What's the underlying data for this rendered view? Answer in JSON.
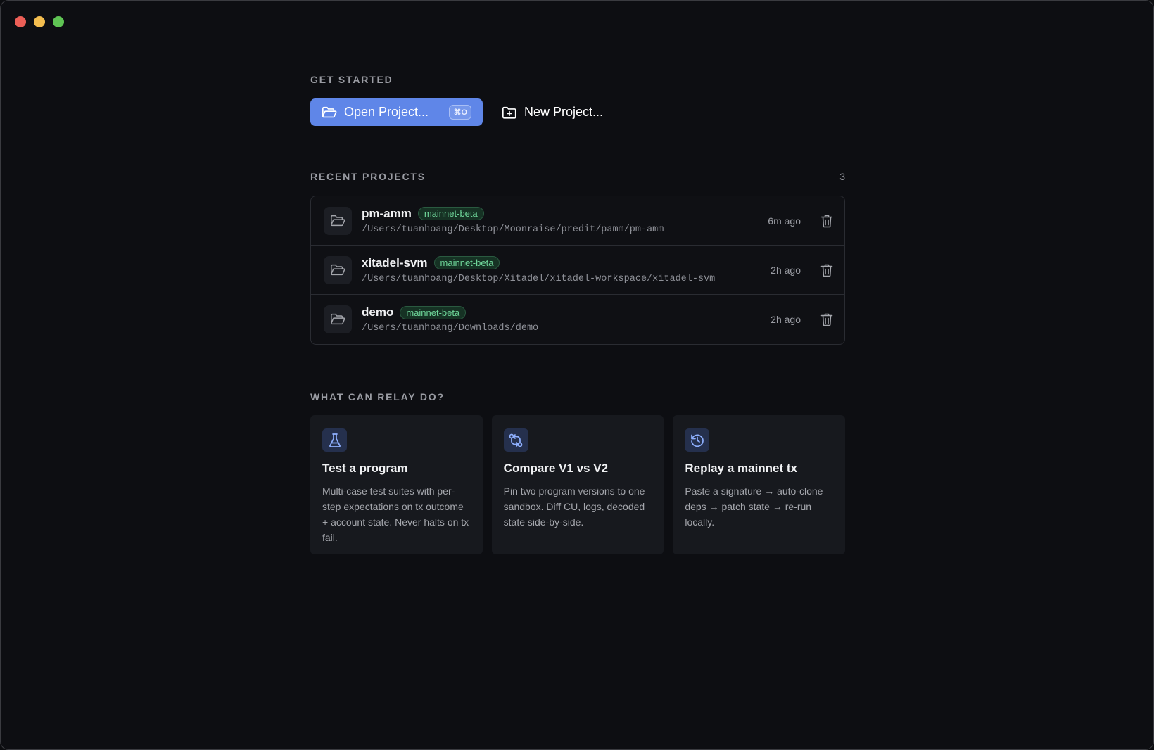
{
  "window": {
    "controls": [
      "close",
      "minimize",
      "zoom"
    ]
  },
  "get_started": {
    "label": "GET STARTED",
    "open_label": "Open Project...",
    "open_shortcut": "⌘O",
    "new_label": "New Project..."
  },
  "recent": {
    "label": "RECENT PROJECTS",
    "count": "3",
    "projects": [
      {
        "name": "pm-amm",
        "network": "mainnet-beta",
        "path": "/Users/tuanhoang/Desktop/Moonraise/predit/pamm/pm-amm",
        "time": "6m ago"
      },
      {
        "name": "xitadel-svm",
        "network": "mainnet-beta",
        "path": "/Users/tuanhoang/Desktop/Xitadel/xitadel-workspace/xitadel-svm",
        "time": "2h ago"
      },
      {
        "name": "demo",
        "network": "mainnet-beta",
        "path": "/Users/tuanhoang/Downloads/demo",
        "time": "2h ago"
      }
    ]
  },
  "features": {
    "label": "WHAT CAN RELAY DO?",
    "cards": [
      {
        "icon": "flask-icon",
        "title": "Test a program",
        "desc": "Multi-case test suites with per-step expectations on tx outcome + account state. Never halts on tx fail."
      },
      {
        "icon": "git-compare-icon",
        "title": "Compare V1 vs V2",
        "desc": "Pin two program versions to one sandbox. Diff CU, logs, decoded state side-by-side."
      },
      {
        "icon": "history-icon",
        "title": "Replay a mainnet tx",
        "desc": "Paste a signature → auto-clone deps → patch state → re-run locally."
      }
    ]
  },
  "colors": {
    "accent": "#5f86e8",
    "badge_text": "#6fd69a",
    "background": "#0d0e12"
  }
}
